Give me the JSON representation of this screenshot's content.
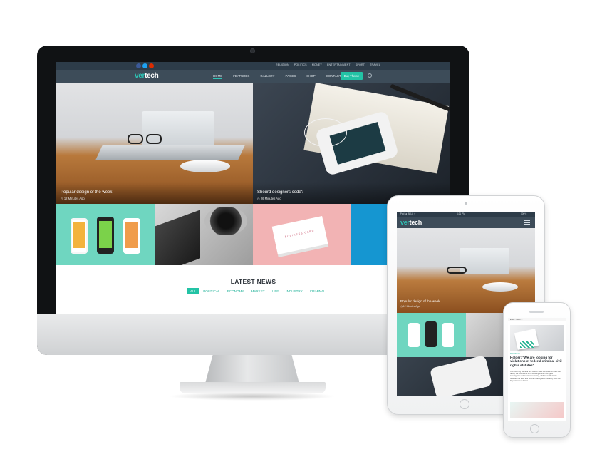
{
  "desktop": {
    "social_colors": [
      "#3b5998",
      "#1da1f2",
      "#dd2c00"
    ],
    "top_nav": [
      "RELIGION",
      "POLITICS",
      "MONEY",
      "ENTERTAINMENT",
      "SPORT",
      "TRAVEL"
    ],
    "logo": {
      "part1": "ver",
      "part2": "tech"
    },
    "main_nav": [
      "HOME",
      "FEATURES",
      "GALLERY",
      "PAGES",
      "SHOP",
      "CONTACT"
    ],
    "active_nav": "HOME",
    "buy_button": "Buy Theme",
    "featured": [
      {
        "title": "Popular design of the week",
        "meta": "12 Minutes Ago"
      },
      {
        "title": "Shourd designers code?",
        "meta": "26 Minutes Ago"
      }
    ],
    "business_card_text": "BUSINESS CARD",
    "latest_news": "LATEST NEWS",
    "filters": [
      "ALL",
      "POLITICAL",
      "ECONOMY",
      "MARKET",
      "LIFE",
      "INDUSTRY",
      "CRIMINAL"
    ]
  },
  "tablet": {
    "status_left": "iPad ◄ BELL ✈",
    "status_time": "4:21 PM",
    "status_right": "100%",
    "logo": {
      "part1": "ver",
      "part2": "tech"
    },
    "featured_title": "Popular design of the week",
    "featured_meta": "12 Minutes Ago"
  },
  "phone": {
    "status": "●●●○○ BELL ✈",
    "category": "POLITICAL",
    "headline": "Holder: \"We are looking for violations of federal criminal civil rights statutes\"",
    "body": "U.S. Attorney General Eric Holder visits Ferguson to meet with family. He comments on a shooting in the 'civil rights' investigation of #ferpolicemontering, additional effectively between the local and federal investigative efficiency from the Department of Justice."
  },
  "colors": {
    "accent": "#23c3a5",
    "header_dark": "#2d3c49",
    "header": "#3d4c59"
  }
}
